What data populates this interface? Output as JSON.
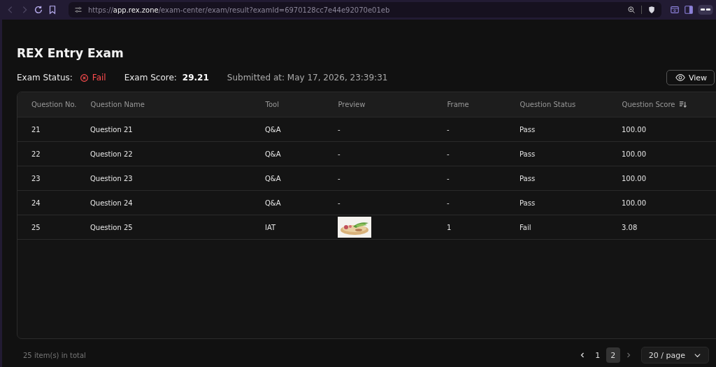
{
  "browser": {
    "url_scheme": "https://",
    "url_host": "app.rex.zone",
    "url_path": "/exam-center/exam/result?examId=6970128cc7e44e92070e01eb"
  },
  "page": {
    "title": "REX Entry Exam",
    "status_label": "Exam Status:",
    "status": "Fail",
    "score_label": "Exam Score:",
    "score": "29.21",
    "submitted": "Submitted at: May 17, 2026, 23:39:31",
    "view_button": "View"
  },
  "table": {
    "columns": [
      {
        "label": "Question No.",
        "sortable": false
      },
      {
        "label": "Question Name",
        "sortable": false
      },
      {
        "label": "Tool",
        "sortable": false
      },
      {
        "label": "Preview",
        "sortable": false
      },
      {
        "label": "Frame",
        "sortable": false
      },
      {
        "label": "Question Status",
        "sortable": false
      },
      {
        "label": "Question Score",
        "sortable": true
      }
    ],
    "rows": [
      {
        "no": "21",
        "name": "Question 21",
        "tool": "Q&A",
        "preview": {
          "kind": "text",
          "text": "-"
        },
        "frame": "-",
        "status": "Pass",
        "score": "100.00"
      },
      {
        "no": "22",
        "name": "Question 22",
        "tool": "Q&A",
        "preview": {
          "kind": "text",
          "text": "-"
        },
        "frame": "-",
        "status": "Pass",
        "score": "100.00"
      },
      {
        "no": "23",
        "name": "Question 23",
        "tool": "Q&A",
        "preview": {
          "kind": "text",
          "text": "-"
        },
        "frame": "-",
        "status": "Pass",
        "score": "100.00"
      },
      {
        "no": "24",
        "name": "Question 24",
        "tool": "Q&A",
        "preview": {
          "kind": "text",
          "text": "-"
        },
        "frame": "-",
        "status": "Pass",
        "score": "100.00"
      },
      {
        "no": "25",
        "name": "Question 25",
        "tool": "IAT",
        "frame": "1",
        "status": "Fail",
        "score": "3.08"
      }
    ]
  },
  "footer": {
    "total": "25 item(s) in total",
    "pages": [
      {
        "label": "1",
        "selected": false
      },
      {
        "label": "2",
        "selected": true
      }
    ],
    "page_size": "20 / page"
  }
}
